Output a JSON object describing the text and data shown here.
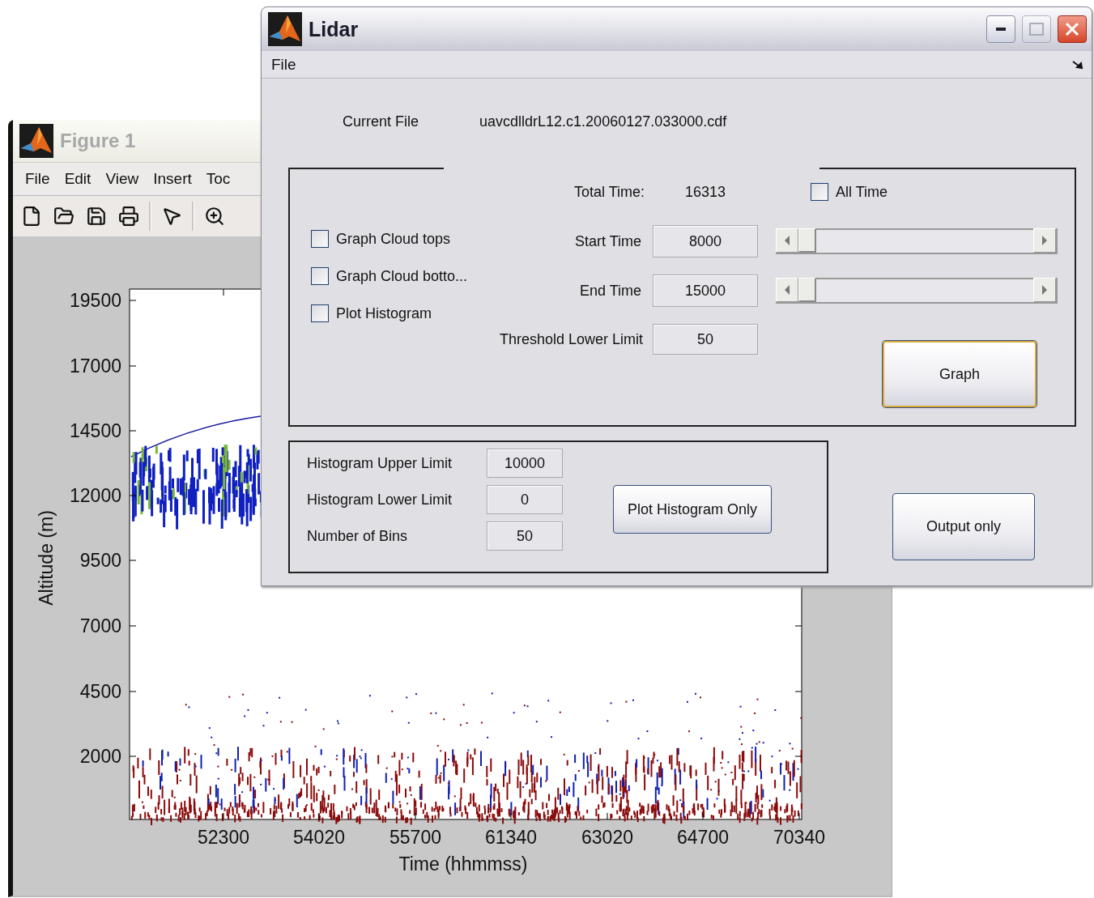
{
  "figure_window": {
    "title": "Figure 1",
    "menu": [
      "File",
      "Edit",
      "View",
      "Insert",
      "Toc"
    ],
    "plot": {
      "ylabel": "Altitude (m)",
      "xlabel": "Time (hhmmss)",
      "yticks": [
        "19500",
        "17000",
        "14500",
        "12000",
        "9500",
        "7000",
        "4500",
        "2000"
      ],
      "xticks": [
        "52300",
        "54020",
        "55700",
        "61340",
        "63020",
        "64700",
        "70340"
      ]
    }
  },
  "lidar_window": {
    "title": "Lidar",
    "menu": [
      "File"
    ],
    "current_file_label": "Current File",
    "current_file": "uavcdlldrL12.c1.20060127.033000.cdf",
    "total_time_label": "Total Time:",
    "total_time": "16313",
    "all_time": {
      "label": "All Time",
      "checked": false
    },
    "options": [
      {
        "label": "Graph Cloud tops",
        "checked": false
      },
      {
        "label": "Graph Cloud botto...",
        "checked": false
      },
      {
        "label": "Plot Histogram",
        "checked": false
      }
    ],
    "start_time": {
      "label": "Start Time",
      "value": "8000",
      "level": 0
    },
    "end_time": {
      "label": "End Time",
      "value": "15000",
      "level": 0
    },
    "threshold": {
      "label": "Threshold Lower Limit",
      "value": "50"
    },
    "graph_button": "Graph",
    "histogram": {
      "fields": [
        {
          "label": "Histogram Upper Limit",
          "value": "10000"
        },
        {
          "label": "Histogram Lower Limit",
          "value": "0"
        },
        {
          "label": "Number of Bins",
          "value": "50"
        }
      ],
      "button": "Plot Histogram Only"
    },
    "output_button": "Output only"
  }
}
